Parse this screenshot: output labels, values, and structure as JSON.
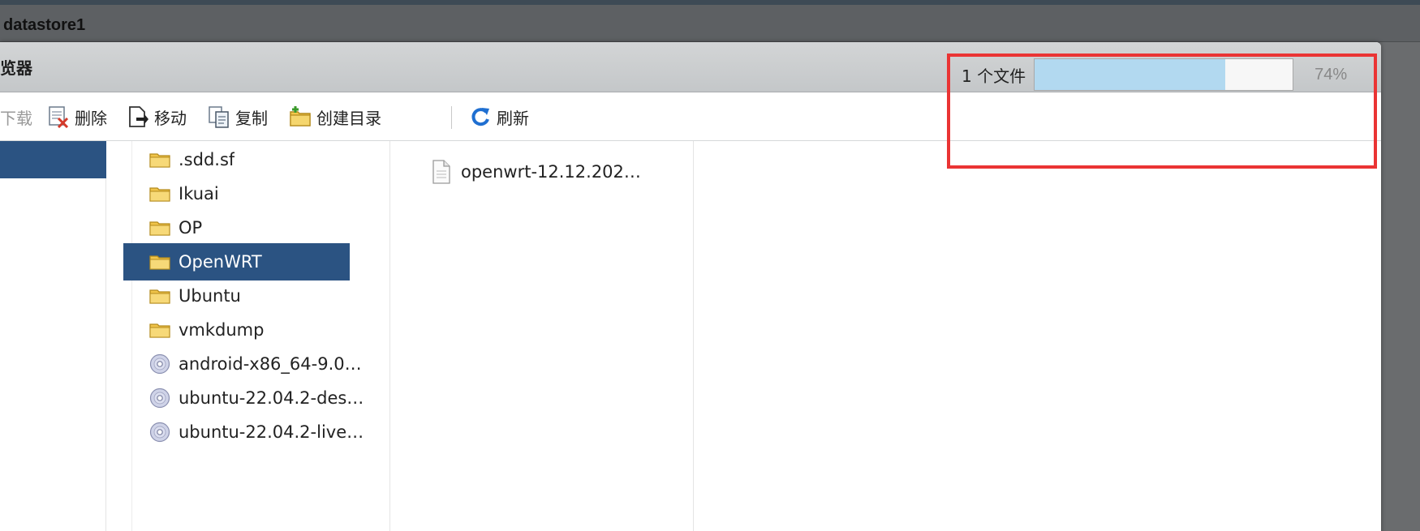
{
  "background": {
    "title": "datastore1"
  },
  "dialog": {
    "title": "览器"
  },
  "toolbar": {
    "download": "下载",
    "delete": "删除",
    "move": "移动",
    "copy": "复制",
    "mkdir": "创建目录",
    "refresh": "刷新"
  },
  "upload": {
    "label": "1 个文件",
    "progress": 0.74,
    "percent": "74%"
  },
  "folders": [
    {
      "name": ".sdd.sf",
      "icon": "folder-icon"
    },
    {
      "name": "Ikuai",
      "icon": "folder-icon"
    },
    {
      "name": "OP",
      "icon": "folder-icon"
    },
    {
      "name": "OpenWRT",
      "icon": "folder-icon",
      "selected": true
    },
    {
      "name": "Ubuntu",
      "icon": "folder-icon"
    },
    {
      "name": "vmkdump",
      "icon": "folder-icon"
    },
    {
      "name": "android-x86_64-9.0…",
      "icon": "disc-icon"
    },
    {
      "name": "ubuntu-22.04.2-des…",
      "icon": "disc-icon"
    },
    {
      "name": "ubuntu-22.04.2-live…",
      "icon": "disc-icon"
    }
  ],
  "files": [
    {
      "name": "openwrt-12.12.202…",
      "icon": "file-icon"
    }
  ],
  "colors": {
    "selection": "#2b5382",
    "progress": "#b2d9f0",
    "highlight": "#ea3434"
  }
}
